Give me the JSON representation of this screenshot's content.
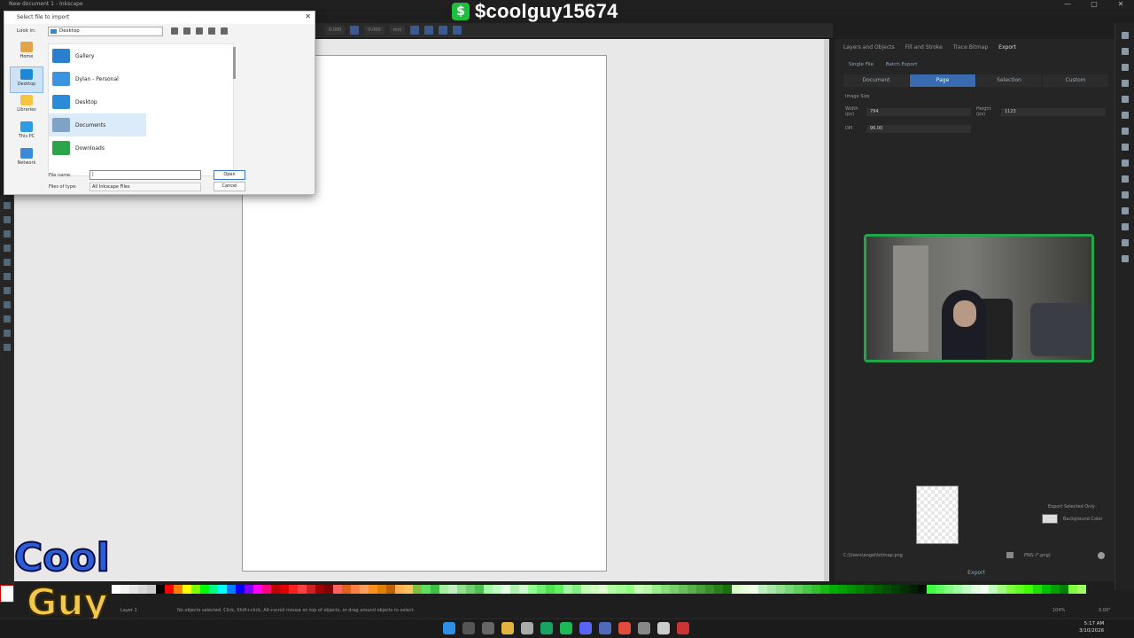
{
  "window": {
    "title": "New document 1 - Inkscape",
    "controls": [
      "—",
      "▢",
      "✕"
    ]
  },
  "donation": {
    "symbol": "$",
    "handle": "$coolguy15674"
  },
  "dialog": {
    "title": "Select file to import",
    "look_in_label": "Look in:",
    "look_in_value": "Desktop",
    "places": [
      {
        "label": "Home",
        "icon": "home-icon",
        "color": "#e4a44a"
      },
      {
        "label": "Desktop",
        "icon": "desktop-icon",
        "color": "#1e88d6"
      },
      {
        "label": "Libraries",
        "icon": "folder-icon",
        "color": "#f5c542"
      },
      {
        "label": "This PC",
        "icon": "pc-icon",
        "color": "#2f9be5"
      },
      {
        "label": "Network",
        "icon": "network-icon",
        "color": "#3a8ad8"
      }
    ],
    "files": [
      {
        "name": "Gallery",
        "icon": "gallery-icon",
        "color": "#2a7fd1"
      },
      {
        "name": "Dylan - Personal",
        "icon": "cloud-icon",
        "color": "#3c93e2"
      },
      {
        "name": "Desktop",
        "icon": "desktop-folder-icon",
        "color": "#2b8ad9"
      },
      {
        "name": "Documents",
        "icon": "documents-icon",
        "color": "#7fa3c6"
      },
      {
        "name": "Downloads",
        "icon": "downloads-icon",
        "color": "#2ea44a"
      }
    ],
    "file_name_label": "File name:",
    "file_name_value": "|",
    "files_of_type_label": "Files of type:",
    "files_of_type_value": "All Inkscape Files",
    "open_label": "Open",
    "cancel_label": "Cancel"
  },
  "dock": {
    "tabs": [
      "Layers and Objects",
      "Fill and Stroke",
      "Trace Bitmap",
      "Export"
    ],
    "export_modes": [
      "Single File",
      "Batch Export"
    ],
    "scopes": [
      "Document",
      "Page",
      "Selection",
      "Custom"
    ],
    "active_scope": "Page",
    "image_size_label": "Image Size",
    "width_label": "Width (px)",
    "width_value": "794",
    "height_label": "Height (px)",
    "height_value": "1123",
    "dpi_label": "DPI",
    "dpi_value": "96.00",
    "export_selected_only": "Export Selected Only",
    "background_color": "Background Color",
    "path_value": "C:\\Users\\angel\\bitmap.png",
    "format_value": "PNG (*.png)",
    "export_label": "Export"
  },
  "toolbar": {
    "x_value": "0.000",
    "y_value": "0.000",
    "unit": "mm"
  },
  "status": {
    "layer": "Layer 1",
    "message": "No objects selected. Click, Shift+click, Alt+scroll mouse on top of objects, or drag around objects to select.",
    "zoom": "104%",
    "rotation": "0.00°"
  },
  "clock": {
    "time": "5:17 AM",
    "date": "3/10/2026"
  },
  "logo": {
    "line1": "Cool",
    "line2": "Guy"
  },
  "palette_colors": [
    "#ffffff",
    "#f2f2f2",
    "#e6e6e6",
    "#d9d9d9",
    "#cccccc",
    "#000000",
    "#ff0000",
    "#ff8000",
    "#ffff00",
    "#80ff00",
    "#00ff00",
    "#00ff80",
    "#00ffff",
    "#0080ff",
    "#0000ff",
    "#8000ff",
    "#ff00ff",
    "#ff0080",
    "#c00000",
    "#e00000",
    "#ff2020",
    "#ff4040",
    "#d02020",
    "#a00000",
    "#800000",
    "#ff6060",
    "#e06020",
    "#ff8040",
    "#ffa060",
    "#ff9020",
    "#e08000",
    "#c06000",
    "#ffb050",
    "#ffc060",
    "#80c040",
    "#60e060",
    "#40c040",
    "#a0f0a0",
    "#c0f0c0",
    "#90e090",
    "#70d070",
    "#50c050",
    "#a0ffa0",
    "#c0ffc0",
    "#e0ffe0",
    "#b0f0b0",
    "#d0f8d0",
    "#90ff90",
    "#70f070",
    "#50e050",
    "#60f060",
    "#a0f8a0",
    "#80f080",
    "#c0ffb0",
    "#d0ffc0",
    "#e0ffd0",
    "#b0ffa0",
    "#a0ff90",
    "#90ff80",
    "#c8ffb8",
    "#b8f8a8",
    "#98f088",
    "#88e078",
    "#78d068",
    "#68c058",
    "#58b048",
    "#48a038",
    "#389028",
    "#288018",
    "#187008",
    "#d8ffc8",
    "#e8ffd8",
    "#f0ffe8",
    "#c0f0c0",
    "#a8e8a8",
    "#90e090",
    "#78d878",
    "#60d060",
    "#48c848",
    "#30c030",
    "#18b818",
    "#00b000",
    "#00a000",
    "#009000",
    "#008000",
    "#007000",
    "#006000",
    "#005000",
    "#004000",
    "#003000",
    "#002000",
    "#001000",
    "#40ff40",
    "#60ff60",
    "#80ff80",
    "#a0ffa0",
    "#c0ffc0",
    "#e0ffe0",
    "#f0fff0",
    "#c0ffc0",
    "#a0ff80",
    "#80ff40",
    "#60ff20",
    "#40ff00",
    "#20e000",
    "#00c000",
    "#00a000",
    "#008000",
    "#80ff40",
    "#a0ff60"
  ]
}
